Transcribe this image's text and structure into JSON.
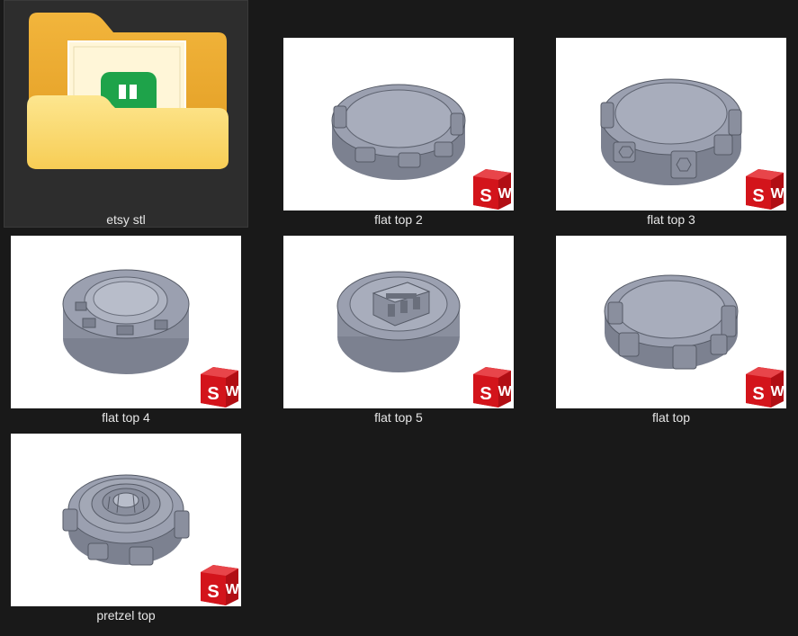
{
  "files": [
    {
      "name": "etsy stl",
      "type": "folder",
      "selected": true
    },
    {
      "name": "flat top 2",
      "type": "solidworks",
      "model": "flat-top-lugs"
    },
    {
      "name": "flat top 3",
      "type": "solidworks",
      "model": "flat-top-hex-lugs"
    },
    {
      "name": "flat top 4",
      "type": "solidworks",
      "model": "cylinder-windows"
    },
    {
      "name": "flat top 5",
      "type": "solidworks",
      "model": "cylinder-usb"
    },
    {
      "name": "flat top",
      "type": "solidworks",
      "model": "flat-top-lugs-tall"
    },
    {
      "name": "pretzel top",
      "type": "solidworks",
      "model": "pretzel"
    }
  ],
  "badge": {
    "text": "SW",
    "color": "#d3141b"
  },
  "colors": {
    "background": "#191919",
    "selection": "#2d2d2d",
    "text": "#e6e6e6",
    "model": "#9ba0b0"
  }
}
